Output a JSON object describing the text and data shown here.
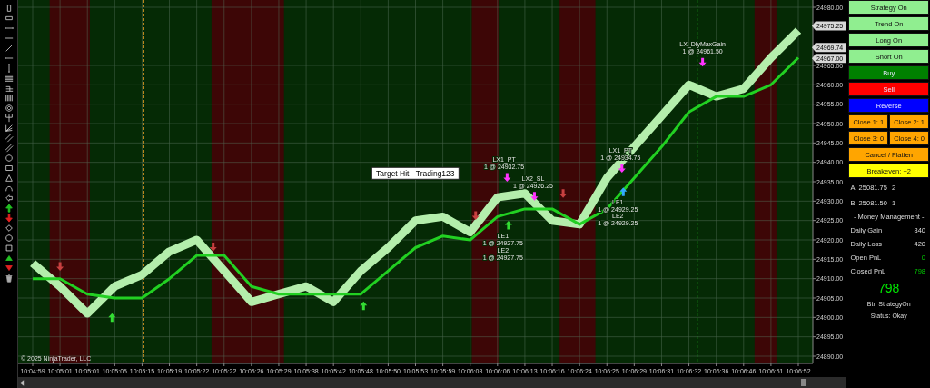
{
  "chart": {
    "copyright": "© 2025 NinjaTrader, LLC",
    "callout": "Target Hit - Trading123",
    "trade_labels": [
      {
        "lines": [
          "LX_DlyMaxGain",
          "1 @ 24961.50"
        ]
      },
      {
        "lines": [
          "LX1_PT",
          "1 @ 24932.75"
        ]
      },
      {
        "lines": [
          "LX2_SL",
          "1 @ 24926.25"
        ]
      },
      {
        "lines": [
          "LX1_PT",
          "1 @ 24934.75"
        ]
      },
      {
        "lines": [
          "LE1",
          "1 @ 24929.25"
        ]
      },
      {
        "lines": [
          "LE2",
          "1 @ 24929.25"
        ]
      },
      {
        "lines": [
          "LE1",
          "1 @ 24927.75"
        ]
      },
      {
        "lines": [
          "LE2",
          "1 @ 24927.75"
        ]
      }
    ],
    "price_flags": [
      "24975.25",
      "24969.74",
      "24967.00"
    ],
    "chart_data": {
      "type": "line",
      "grid": true,
      "categories": [
        "10:04:59",
        "10:05:01",
        "10:05:01",
        "10:05:05",
        "10:05:15",
        "10:05:19",
        "10:05:22",
        "10:05:22",
        "10:05:26",
        "10:05:29",
        "10:05:38",
        "10:05:42",
        "10:05:48",
        "10:05:50",
        "10:05:53",
        "10:05:59",
        "10:06:03",
        "10:06:06",
        "10:06:13",
        "10:06:16",
        "10:06:24",
        "10:06:25",
        "10:06:29",
        "10:06:31",
        "10:06:32",
        "10:06:36",
        "10:06:46",
        "10:06:51",
        "10:06:52"
      ],
      "series": [
        {
          "color": "#b4eeac",
          "values": [
            24914,
            24908,
            24901,
            24908,
            24911,
            24917,
            24920,
            24912,
            24904,
            24906,
            24908,
            24904,
            24912,
            24918,
            24925,
            24926,
            24922,
            24931,
            24932,
            24925,
            24924,
            24936,
            24944,
            24952,
            24960,
            24957,
            24959,
            24967,
            24974
          ]
        },
        {
          "color": "#22d022",
          "values": [
            24910,
            24910,
            24906,
            24905,
            24905,
            24910,
            24916,
            24916,
            24908,
            24906,
            24906,
            24906,
            24906,
            24912,
            24918,
            24921,
            24920,
            24926,
            24928,
            24928,
            24924,
            24928,
            24936,
            24944,
            24953,
            24957,
            24957,
            24960,
            24967
          ]
        }
      ],
      "ylim": [
        24890,
        24980
      ],
      "yticks": [
        {
          "value": 24980,
          "label": "24980.00"
        },
        {
          "value": 24965,
          "label": "24965.00"
        },
        {
          "value": 24960,
          "label": "24960.00"
        },
        {
          "value": 24955,
          "label": "24955.00"
        },
        {
          "value": 24950,
          "label": "24950.00"
        },
        {
          "value": 24945,
          "label": "24945.00"
        },
        {
          "value": 24940,
          "label": "24940.00"
        },
        {
          "value": 24935,
          "label": "24935.00"
        },
        {
          "value": 24930,
          "label": "24930.00"
        },
        {
          "value": 24925,
          "label": "24925.00"
        },
        {
          "value": 24920,
          "label": "24920.00"
        },
        {
          "value": 24915,
          "label": "24915.00"
        },
        {
          "value": 24910,
          "label": "24910.00"
        },
        {
          "value": 24905,
          "label": "24905.00"
        },
        {
          "value": 24900,
          "label": "24900.00"
        },
        {
          "value": 24895,
          "label": "24895.00"
        },
        {
          "value": 24890,
          "label": "24890.00"
        }
      ]
    }
  },
  "panel": {
    "buttons": [
      {
        "label": "Strategy On",
        "color": "#90ee90"
      },
      {
        "label": "Trend On",
        "color": "#90ee90"
      },
      {
        "label": "Long On",
        "color": "#90ee90"
      },
      {
        "label": "Short On",
        "color": "#90ee90"
      },
      {
        "label": "Buy",
        "color": "#008000"
      },
      {
        "label": "Sell",
        "color": "#ff0000"
      },
      {
        "label": "Reverse",
        "color": "#0000ff"
      }
    ],
    "close_buttons": [
      {
        "label": "Close 1:  1",
        "color": "#ffa500"
      },
      {
        "label": "Close 2:  1",
        "color": "#ffa500"
      },
      {
        "label": "Close 3:  0",
        "color": "#ffa500"
      },
      {
        "label": "Close 4:  0",
        "color": "#ffa500"
      }
    ],
    "bottom_buttons": [
      {
        "label": "Cancel / Flatten",
        "color": "#ffa500"
      },
      {
        "label": "Breakeven:  +2",
        "color": "#ffff00"
      }
    ],
    "quotes": [
      {
        "label": "A: 25081.75",
        "value": "2"
      },
      {
        "label": "B: 25081.50",
        "value": "1"
      }
    ],
    "money_title": "-  Money Management  -",
    "money_rows": [
      {
        "label": "Daily Gain",
        "value": "840",
        "highlight": false
      },
      {
        "label": "Daily Loss",
        "value": "420",
        "highlight": false
      },
      {
        "label": "Open PnL",
        "value": "0",
        "highlight": true
      },
      {
        "label": "Closed PnL",
        "value": "798",
        "highlight": true
      }
    ],
    "total": "798",
    "button_status": "Btn StrategyOn",
    "status": "Status: Okay"
  }
}
